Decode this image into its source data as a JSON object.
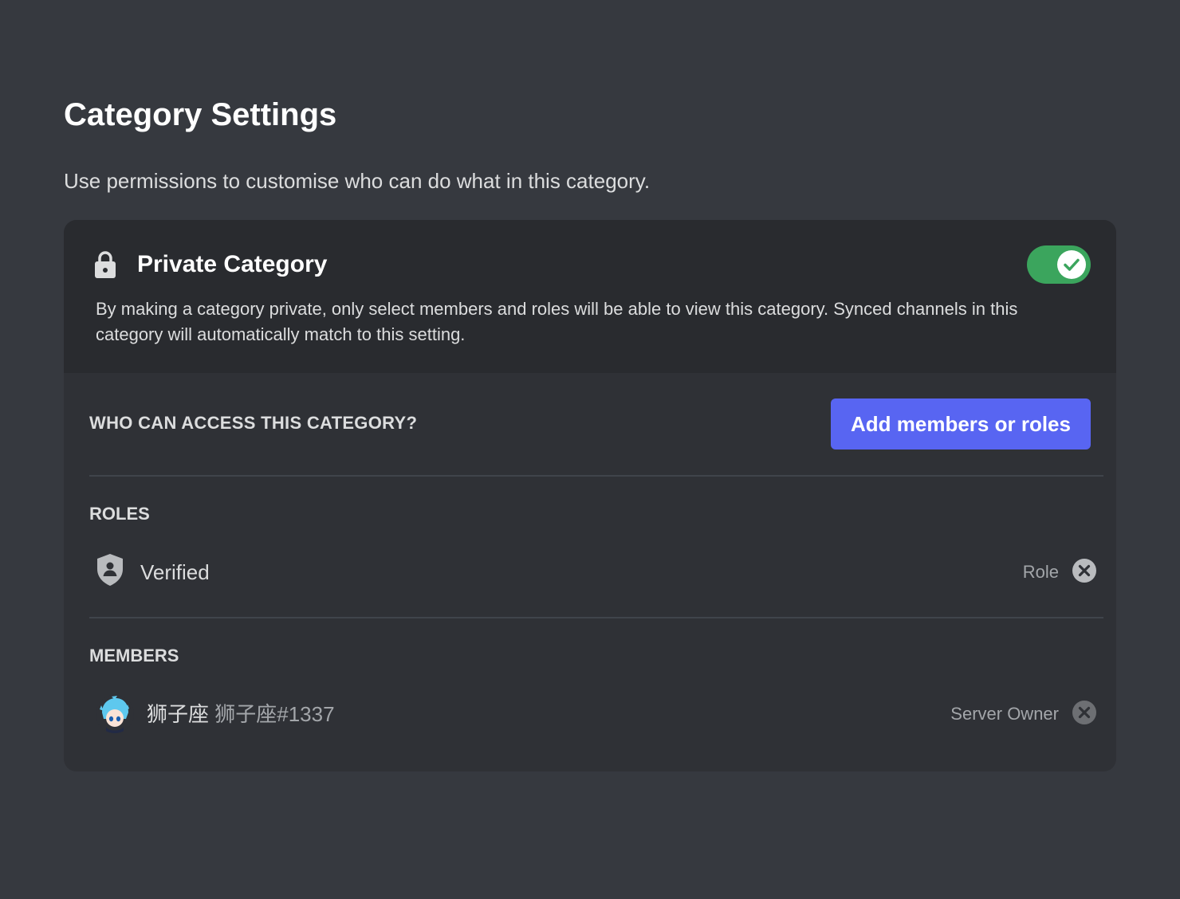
{
  "page": {
    "title": "Category Settings",
    "subtitle": "Use permissions to customise who can do what in this category."
  },
  "private_category": {
    "icon": "lock-icon",
    "title": "Private Category",
    "description": "By making a category private, only select members and roles will be able to view this category. Synced channels in this category will automatically match to this setting.",
    "toggle_enabled": true,
    "toggle_color": "#3ba55d"
  },
  "access": {
    "heading": "WHO CAN ACCESS THIS CATEGORY?",
    "add_button_label": "Add members or roles",
    "add_button_color": "#5865f2"
  },
  "roles": {
    "heading": "ROLES",
    "items": [
      {
        "icon": "shield-user-icon",
        "name": "Verified",
        "type": "Role"
      }
    ]
  },
  "members": {
    "heading": "MEMBERS",
    "items": [
      {
        "icon": "avatar",
        "display_name": "狮子座",
        "username": "狮子座#1337",
        "type": "Server Owner"
      }
    ]
  }
}
